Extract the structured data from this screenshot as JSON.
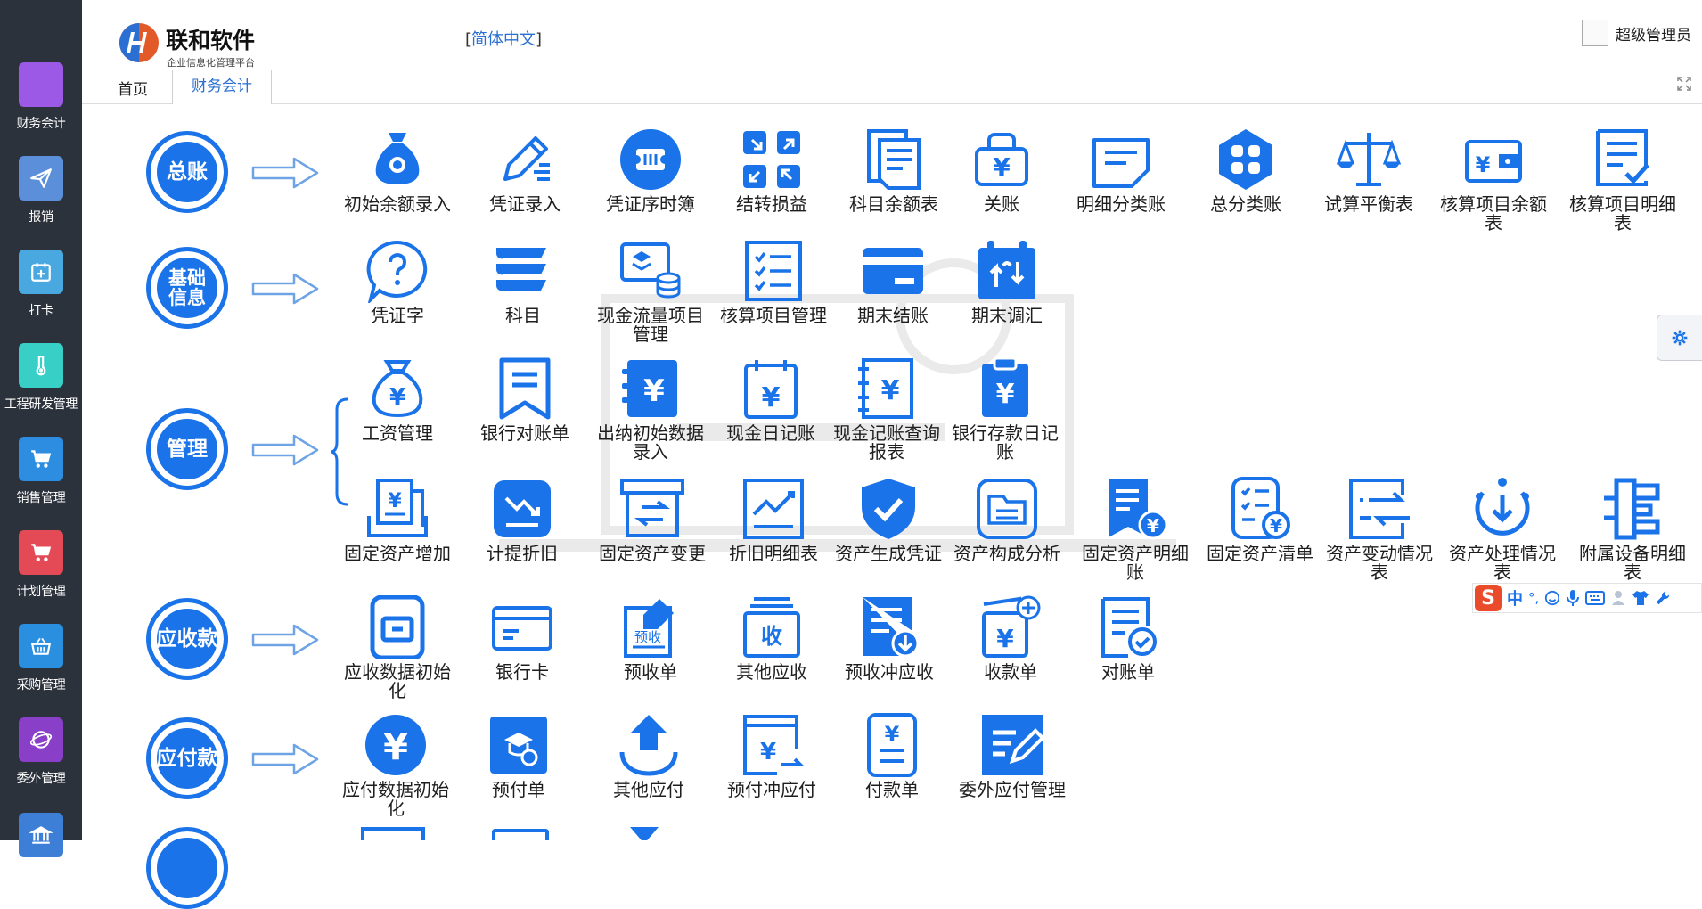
{
  "sidebar": {
    "items": [
      {
        "label": "财务会计",
        "icon": "square-icon",
        "color": "#9b59e6"
      },
      {
        "label": "报销",
        "icon": "paper-plane-icon",
        "color": "#5b8fd9"
      },
      {
        "label": "打卡",
        "icon": "calendar-plus-icon",
        "color": "#4aa8e0"
      },
      {
        "label": "工程研发管理",
        "icon": "thermometer-icon",
        "color": "#38cfc6"
      },
      {
        "label": "销售管理",
        "icon": "cart-icon",
        "color": "#2d8de0"
      },
      {
        "label": "计划管理",
        "icon": "cart-icon",
        "color": "#e44a55"
      },
      {
        "label": "采购管理",
        "icon": "basket-icon",
        "color": "#2b8fe0"
      },
      {
        "label": "委外管理",
        "icon": "globe-icon",
        "color": "#8a3fc9"
      },
      {
        "label": "",
        "icon": "bank-icon",
        "color": "#3d7fd6"
      }
    ]
  },
  "header": {
    "brand": "联和软件",
    "brand_sub": "企业信息化管理平台",
    "lang_open": "[",
    "lang_link": "简体中文",
    "lang_close": "]",
    "user_name": "超级管理员"
  },
  "tabs": {
    "home": "首页",
    "active": "财务会计"
  },
  "categories": [
    {
      "label": "总账",
      "items": [
        {
          "label": "初始余额录入",
          "icon": "money-bag-icon"
        },
        {
          "label": "凭证录入",
          "icon": "pen-edit-icon"
        },
        {
          "label": "凭证序时簿",
          "icon": "ticket-icon"
        },
        {
          "label": "结转损益",
          "icon": "transfer-arrows-icon"
        },
        {
          "label": "科目余额表",
          "icon": "documents-icon"
        },
        {
          "label": "关账",
          "icon": "yen-bag-icon"
        },
        {
          "label": "明细分类账",
          "icon": "note-icon"
        },
        {
          "label": "总分类账",
          "icon": "grid-circle-icon"
        },
        {
          "label": "试算平衡表",
          "icon": "scale-icon"
        },
        {
          "label": "核算项目余额表",
          "icon": "wallet-yen-icon"
        },
        {
          "label": "核算项目明细表",
          "icon": "doc-check-icon"
        }
      ]
    },
    {
      "label": "基础信息",
      "items": [
        {
          "label": "凭证字",
          "icon": "question-icon"
        },
        {
          "label": "科目",
          "icon": "books-icon"
        },
        {
          "label": "现金流量项目管理",
          "icon": "cash-stack-icon"
        },
        {
          "label": "核算项目管理",
          "icon": "checklist-icon"
        },
        {
          "label": "期末结账",
          "icon": "card-icon"
        },
        {
          "label": "期末调汇",
          "icon": "calendar-exchange-icon"
        }
      ]
    },
    {
      "label": "管理",
      "items": [
        {
          "label": "工资管理",
          "icon": "salary-bag-icon"
        },
        {
          "label": "银行对账单",
          "icon": "receipt-icon"
        },
        {
          "label": "出纳初始数据录入",
          "icon": "cashier-book-icon"
        },
        {
          "label": "现金日记账",
          "icon": "calendar-yen-icon"
        },
        {
          "label": "现金记账查询报表",
          "icon": "ledger-yen-icon"
        },
        {
          "label": "银行存款日记账",
          "icon": "clipboard-yen-icon"
        },
        {
          "label": "固定资产增加",
          "icon": "asset-add-icon"
        },
        {
          "label": "计提折旧",
          "icon": "chart-down-icon"
        },
        {
          "label": "固定资产变更",
          "icon": "box-exchange-icon"
        },
        {
          "label": "折旧明细表",
          "icon": "chart-line-icon"
        },
        {
          "label": "资产生成凭证",
          "icon": "shield-check-icon"
        },
        {
          "label": "资产构成分析",
          "icon": "folder-list-icon"
        },
        {
          "label": "固定资产明细账",
          "icon": "doc-yen-icon"
        },
        {
          "label": "固定资产清单",
          "icon": "list-yen-icon"
        },
        {
          "label": "资产变动情况表",
          "icon": "swap-doc-icon"
        },
        {
          "label": "资产处理情况表",
          "icon": "circle-down-icon"
        },
        {
          "label": "附属设备明细表",
          "icon": "equipment-icon"
        }
      ]
    },
    {
      "label": "应收款",
      "items": [
        {
          "label": "应收数据初始化",
          "icon": "phone-card-icon"
        },
        {
          "label": "银行卡",
          "icon": "bank-card-icon"
        },
        {
          "label": "预收单",
          "icon": "prereceipt-icon"
        },
        {
          "label": "其他应收",
          "icon": "inbox-icon"
        },
        {
          "label": "预收冲应收",
          "icon": "doc-download-icon"
        },
        {
          "label": "收款单",
          "icon": "yen-add-icon"
        },
        {
          "label": "对账单",
          "icon": "doc-confirm-icon"
        }
      ]
    },
    {
      "label": "应付款",
      "items": [
        {
          "label": "应付数据初始化",
          "icon": "yen-circle-icon"
        },
        {
          "label": "预付单",
          "icon": "graduate-icon"
        },
        {
          "label": "其他应付",
          "icon": "upload-tray-icon"
        },
        {
          "label": "预付冲应付",
          "icon": "window-yen-icon"
        },
        {
          "label": "付款单",
          "icon": "doc-yen-lines-icon"
        },
        {
          "label": "委外应付管理",
          "icon": "edit-square-icon"
        }
      ]
    }
  ],
  "ime": {
    "logo": "S",
    "lang": "中",
    "punct": "°,",
    "tools": [
      "smile-icon",
      "mic-icon",
      "keyboard-icon",
      "person-icon",
      "shirt-icon",
      "wrench-icon"
    ]
  },
  "colors": {
    "accent": "#1a73e8",
    "sidebar_bg": "#2c323c"
  }
}
